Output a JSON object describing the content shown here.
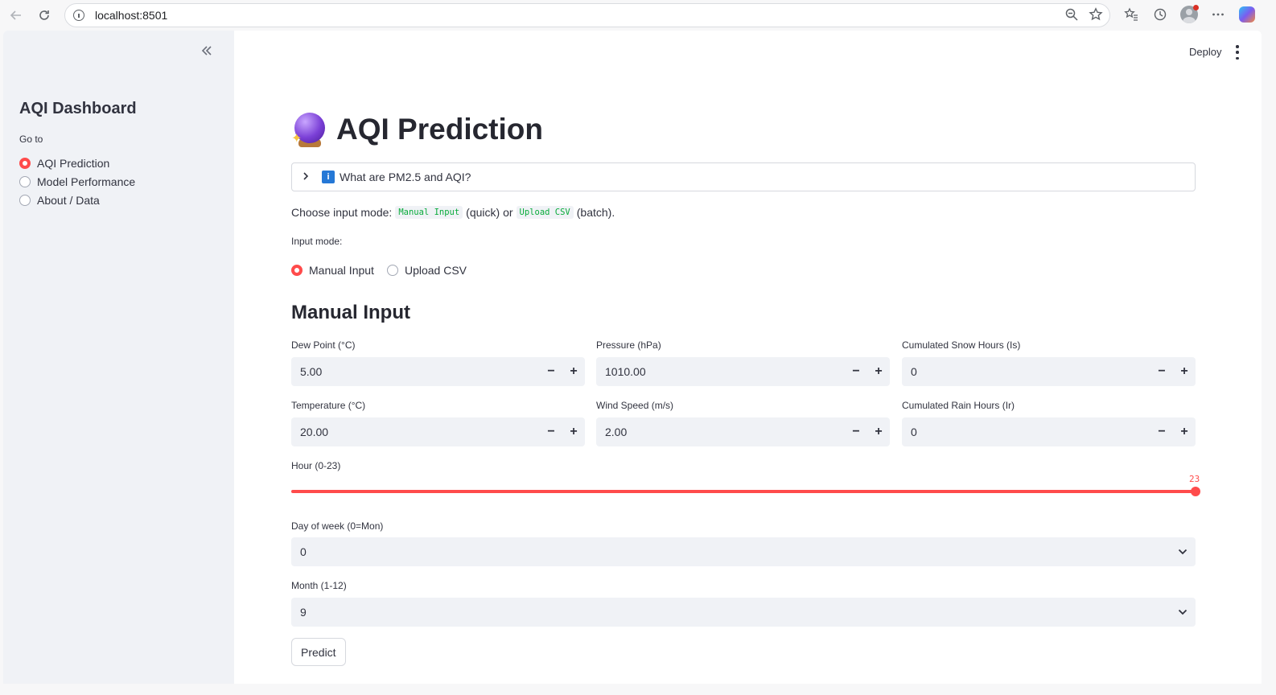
{
  "browser": {
    "url": "localhost:8501"
  },
  "sidebar": {
    "title": "AQI Dashboard",
    "goto_label": "Go to",
    "pages": [
      {
        "label": "AQI Prediction",
        "selected": true
      },
      {
        "label": "Model Performance",
        "selected": false
      },
      {
        "label": "About / Data",
        "selected": false
      }
    ]
  },
  "header": {
    "deploy_label": "Deploy"
  },
  "main": {
    "title": "AQI Prediction",
    "title_icon": "crystal-ball-icon",
    "expander_label": "What are PM2.5 and AQI?",
    "intro": {
      "prefix": "Choose input mode:",
      "code1": "Manual Input",
      "mid": "(quick) or",
      "code2": "Upload CSV",
      "suffix": "(batch)."
    },
    "mode_label": "Input mode:",
    "modes": [
      {
        "label": "Manual Input",
        "selected": true
      },
      {
        "label": "Upload CSV",
        "selected": false
      }
    ],
    "section_title": "Manual Input",
    "fields": {
      "dew_point": {
        "label": "Dew Point (°C)",
        "value": "5.00"
      },
      "pressure": {
        "label": "Pressure (hPa)",
        "value": "1010.00"
      },
      "snow_hours": {
        "label": "Cumulated Snow Hours (Is)",
        "value": "0"
      },
      "temperature": {
        "label": "Temperature (°C)",
        "value": "20.00"
      },
      "wind_speed": {
        "label": "Wind Speed (m/s)",
        "value": "2.00"
      },
      "rain_hours": {
        "label": "Cumulated Rain Hours (Ir)",
        "value": "0"
      }
    },
    "hour_slider": {
      "label": "Hour (0-23)",
      "value": "23",
      "min": 0,
      "max": 23
    },
    "day_of_week": {
      "label": "Day of week (0=Mon)",
      "value": "0"
    },
    "month": {
      "label": "Month (1-12)",
      "value": "9"
    },
    "predict_label": "Predict",
    "step_minus": "−",
    "step_plus": "+"
  },
  "colors": {
    "accent": "#ff4b4b",
    "sidebar_bg": "#f0f2f6",
    "code_text": "#09ab3b"
  }
}
